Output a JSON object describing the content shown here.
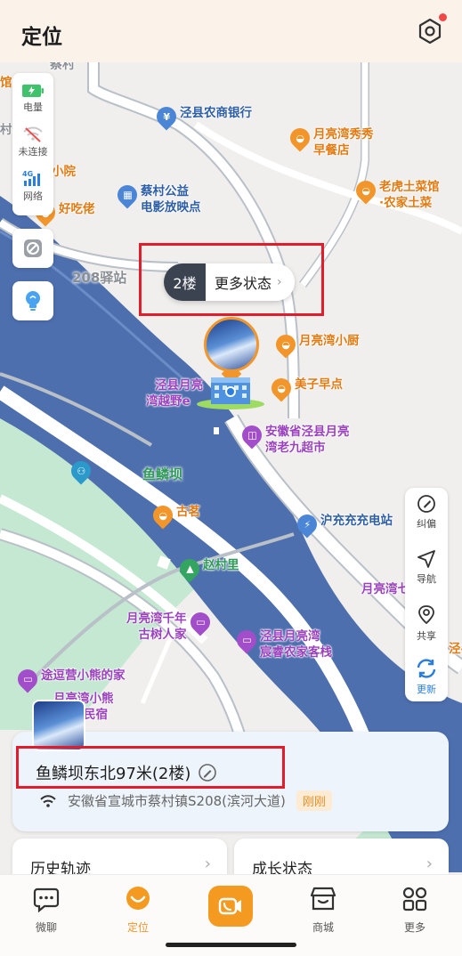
{
  "header": {
    "title": "定位"
  },
  "status": [
    {
      "label": "电量",
      "icon": "battery-charging-icon"
    },
    {
      "label": "未连接",
      "icon": "wifi-off-icon"
    },
    {
      "label": "网络",
      "icon": "4g-signal-icon"
    }
  ],
  "floor": {
    "number": "2楼",
    "more": "更多状态"
  },
  "map": {
    "road_label": "208驿站",
    "village_top": "蔡村",
    "area_label": "鱼鳞坝",
    "pois": {
      "bank": "泾县农商银行",
      "cinema_1": "蔡村公益",
      "cinema_2": "电影放映点",
      "breakfast_1": "月亮湾秀秀",
      "breakfast_2": "早餐店",
      "farmhouse_1": "老虎土菜馆",
      "farmhouse_2": "·农家土菜",
      "kitchen": "月亮湾小厨",
      "meizi": "美子早点",
      "supermarket_1": "安徽省泾县月亮",
      "supermarket_2": "湾老九超市",
      "yuexiang_1": "泾县月亮",
      "yuexiang_2": "湾越野e",
      "charging": "沪充充充电站",
      "guming": "古茗",
      "zhaocun": "赵村里",
      "tree_1": "月亮湾千年",
      "tree_2": "古树人家",
      "chenrui_1": "泾县月亮湾",
      "chenrui_2": "宸睿农家客栈",
      "bear": "途逗营小熊的家",
      "bear2_1": "月亮湾小熊",
      "bear2_2": "民宿",
      "qilai": "月亮湾七来民宿",
      "right_edge": "泾县",
      "haochi": "好吃佬",
      "yuan": "小院",
      "guan": "馆",
      "cun": "村"
    }
  },
  "tools": [
    {
      "label": "纠偏",
      "icon": "correction-icon"
    },
    {
      "label": "导航",
      "icon": "navigation-icon"
    },
    {
      "label": "共享",
      "icon": "share-location-icon"
    },
    {
      "label": "更新",
      "icon": "refresh-icon"
    }
  ],
  "location": {
    "title": "鱼鳞坝东北97米(2楼)",
    "address": "安徽省宣城市蔡村镇S208(滨河大道)",
    "badge": "刚刚"
  },
  "cards": {
    "history": "历史轨迹",
    "growth": "成长状态"
  },
  "tabs": [
    {
      "label": "微聊",
      "icon": "chat-icon"
    },
    {
      "label": "定位",
      "icon": "location-icon"
    },
    {
      "label": "",
      "icon": "video-call-icon"
    },
    {
      "label": "商城",
      "icon": "store-icon"
    },
    {
      "label": "更多",
      "icon": "more-grid-icon"
    }
  ],
  "colors": {
    "accent": "#f2952a",
    "highlight_box": "#e21c2a",
    "river": "#4d6fae",
    "park": "#bfe6cd"
  }
}
